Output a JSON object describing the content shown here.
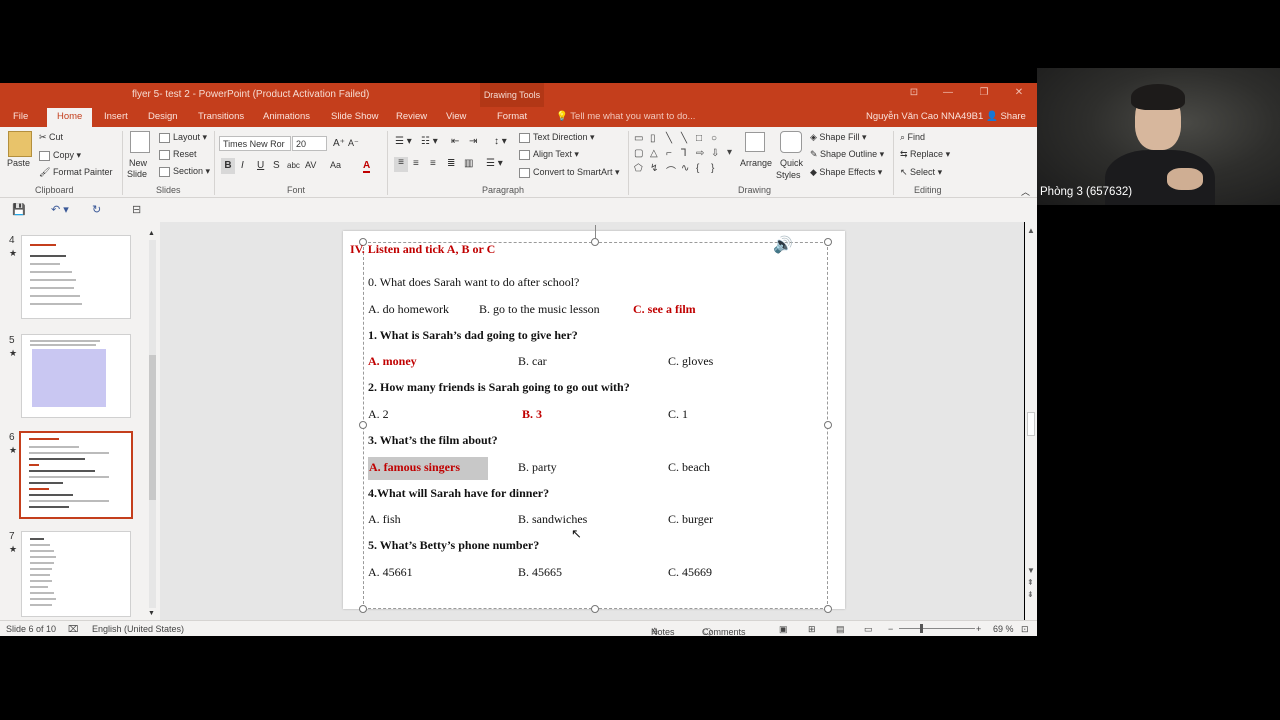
{
  "window": {
    "title": "flyer 5- test 2 - PowerPoint (Product Activation Failed)",
    "contextual_tab_group": "Drawing Tools",
    "minimize": "—",
    "restore": "❐",
    "close": "✕",
    "ribbon_display": "⊡"
  },
  "tabs": {
    "items": [
      "File",
      "Home",
      "Insert",
      "Design",
      "Transitions",
      "Animations",
      "Slide Show",
      "Review",
      "View",
      "Format"
    ],
    "tell_me": "Tell me what you want to do...",
    "user": "Nguyễn Văn Cao NNA49B1",
    "share": "Share"
  },
  "ribbon": {
    "clipboard": {
      "label": "Clipboard",
      "paste": "Paste",
      "cut": "Cut",
      "copy": "Copy",
      "format_painter": "Format Painter"
    },
    "slides": {
      "label": "Slides",
      "new_slide_1": "New",
      "new_slide_2": "Slide",
      "layout": "Layout",
      "reset": "Reset",
      "section": "Section"
    },
    "font": {
      "label": "Font",
      "font_name": "Times New Ror",
      "font_size": "20",
      "bold": "B",
      "italic": "I",
      "underline": "U",
      "strike": "S",
      "shadow": "abc",
      "spacing": "AV",
      "case": "Aa",
      "color": "A"
    },
    "paragraph": {
      "label": "Paragraph",
      "text_direction": "Text Direction",
      "align_text": "Align Text",
      "convert_smartart": "Convert to SmartArt"
    },
    "drawing": {
      "label": "Drawing",
      "arrange": "Arrange",
      "quick_styles_1": "Quick",
      "quick_styles_2": "Styles",
      "shape_fill": "Shape Fill",
      "shape_outline": "Shape Outline",
      "shape_effects": "Shape Effects"
    },
    "editing": {
      "label": "Editing",
      "find": "Find",
      "replace": "Replace",
      "select": "Select"
    }
  },
  "thumbnails": [
    {
      "number": "4",
      "star": "★"
    },
    {
      "number": "5",
      "star": "★"
    },
    {
      "number": "6",
      "star": "★"
    },
    {
      "number": "7",
      "star": "★"
    }
  ],
  "slide": {
    "heading": "IV. Listen and tick A, B or C",
    "q0": "0. What does Sarah want to do after school?",
    "q0_a": "A. do homework",
    "q0_b": "B. go to the music lesson",
    "q0_c": "C. see a film",
    "q1": "1. What is Sarah’s dad going to give her?",
    "q1_a": "A. money",
    "q1_b": "B. car",
    "q1_c": "C.  gloves",
    "q2": "2. How many friends is Sarah going to go out with?",
    "q2_a": "A. 2",
    "q2_b": "B. 3",
    "q2_c": "C. 1",
    "q3": "3. What’s the film about?",
    "q3_a": "A. famous singers",
    "q3_b": "B. party",
    "q3_c": "C. beach",
    "q4": "4.What will Sarah have for dinner?",
    "q4_a": "A. fish",
    "q4_b": "B. sandwiches",
    "q4_c": "C. burger",
    "q5": "5.  What’s Betty’s phone number?",
    "q5_a": "A. 45661",
    "q5_b": "B. 45665",
    "q5_c": "C. 45669"
  },
  "status": {
    "slide_info": "Slide 6 of 10",
    "language": "English (United States)",
    "notes": "Notes",
    "comments": "Comments",
    "zoom": "69 %"
  },
  "webcam": {
    "label": "Phòng 3 (657632)"
  }
}
